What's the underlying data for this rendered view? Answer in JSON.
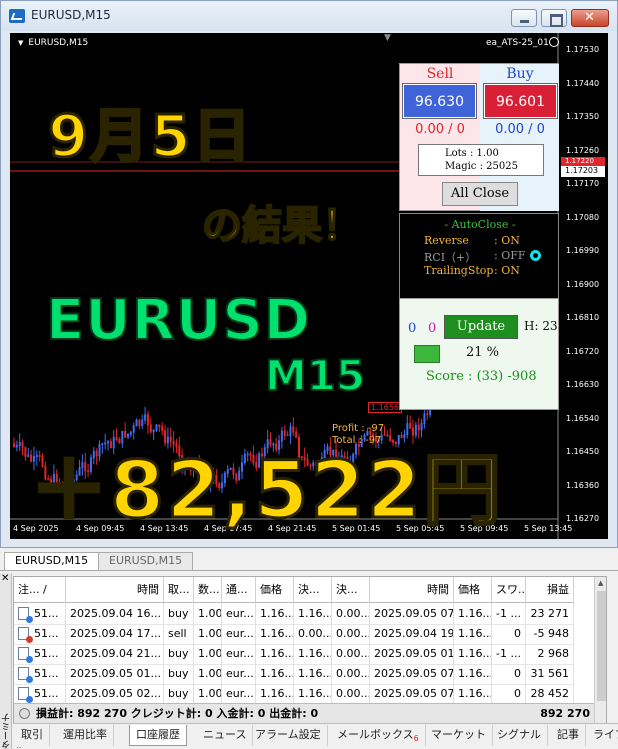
{
  "window": {
    "title": "EURUSD,M15"
  },
  "chart": {
    "symbol_label": "EURUSD,M15",
    "ea_label": "ea_ATS-25_01",
    "current_price": "1.17203",
    "current_price_red": "1.17220",
    "y_labels": [
      "1.17530",
      "1.17440",
      "1.17350",
      "1.17260",
      "1.17170",
      "1.17080",
      "1.16990",
      "1.16900",
      "1.16810",
      "1.16720",
      "1.16630",
      "1.16540",
      "1.16450",
      "1.16360",
      "1.16270"
    ],
    "x_labels": [
      "4 Sep 2025",
      "4 Sep 09:45",
      "4 Sep 13:45",
      "4 Sep 17:45",
      "4 Sep 21:45",
      "5 Sep 01:45",
      "5 Sep 05:45",
      "5 Sep 09:45",
      "5 Sep 13:45"
    ],
    "profit_label_1": "Profit : -97",
    "profit_label_2": "Total : -97",
    "price_box": "1.1656"
  },
  "overlay": {
    "date": "9月5日",
    "result": "の結果！",
    "pair": "EURUSD",
    "timeframe": "M15",
    "profit": "＋82,522円"
  },
  "trade_panel": {
    "sell_header": "Sell",
    "buy_header": "Buy",
    "sell_price": "96.630",
    "buy_price": "96.601",
    "sell_pos": "0.00 / 0",
    "buy_pos": "0.00 / 0",
    "lots": "Lots   : 1.00",
    "magic": "Magic : 25025",
    "all_close": "All Close"
  },
  "autoclose_panel": {
    "title": "- AutoClose -",
    "rows": [
      {
        "label": "Reverse",
        "value": ": ON"
      },
      {
        "label": "RCI（+）",
        "value": ": OFF"
      },
      {
        "label": "TrailingStop",
        "value": ": ON"
      }
    ]
  },
  "update_panel": {
    "n1": "0",
    "n2": "0",
    "update": "Update",
    "h": "H: 23",
    "pct": "21 %",
    "score": "Score : (33) -908"
  },
  "terminal": {
    "chart_tabs": [
      "EURUSD,M15",
      "EURUSD,M15"
    ],
    "side_label": "ターミナル",
    "columns": [
      "注...",
      "/",
      "時間",
      "取...",
      "数...",
      "通...",
      "価格",
      "決...",
      "決...",
      "時間",
      "価格",
      "スワ...",
      "損益"
    ],
    "rows": [
      {
        "ticket": "51...",
        "open_time": "2025.09.04 16...",
        "type": "buy",
        "size": "1.00",
        "symbol": "eur...",
        "price": "1.16...",
        "sl": "1.16...",
        "tp": "0.00...",
        "close_time": "2025.09.05 07...",
        "close_price": "1.16...",
        "swap": "-1 ...",
        "profit": "23 271"
      },
      {
        "ticket": "51...",
        "open_time": "2025.09.04 17...",
        "type": "sell",
        "size": "1.00",
        "symbol": "eur...",
        "price": "1.16...",
        "sl": "0.00...",
        "tp": "0.00...",
        "close_time": "2025.09.04 19...",
        "close_price": "1.16...",
        "swap": "0",
        "profit": "-5 948"
      },
      {
        "ticket": "51...",
        "open_time": "2025.09.04 21...",
        "type": "buy",
        "size": "1.00",
        "symbol": "eur...",
        "price": "1.16...",
        "sl": "1.16...",
        "tp": "0.00...",
        "close_time": "2025.09.05 01...",
        "close_price": "1.16...",
        "swap": "-1 ...",
        "profit": "2 968"
      },
      {
        "ticket": "51...",
        "open_time": "2025.09.05 01...",
        "type": "buy",
        "size": "1.00",
        "symbol": "eur...",
        "price": "1.16...",
        "sl": "1.16...",
        "tp": "0.00...",
        "close_time": "2025.09.05 07...",
        "close_price": "1.16...",
        "swap": "0",
        "profit": "31 561"
      },
      {
        "ticket": "51...",
        "open_time": "2025.09.05 02...",
        "type": "buy",
        "size": "1.00",
        "symbol": "eur...",
        "price": "1.16...",
        "sl": "1.16...",
        "tp": "0.00...",
        "close_time": "2025.09.05 07...",
        "close_price": "1.16...",
        "swap": "0",
        "profit": "28 452"
      }
    ],
    "summary_text": "損益計: 892 270  クレジット計: 0  入金計: 0  出金計: 0",
    "summary_total": "892 270",
    "bottom_tabs": [
      "取引",
      "運用比率",
      "口座履歴",
      "ニュース",
      "アラーム設定",
      "メールボックス",
      "マーケット",
      "シグナル",
      "記事",
      "ライブ"
    ],
    "mailbox_badge": "6",
    "active_tab": "口座履歴"
  }
}
